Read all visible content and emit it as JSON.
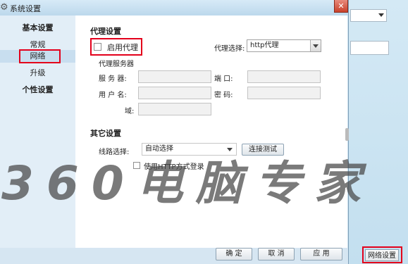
{
  "window": {
    "title": "系统设置",
    "close_label": "✕"
  },
  "sidebar": {
    "sections": [
      {
        "heading": "基本设置",
        "items": [
          "常规",
          "网络",
          "升级"
        ]
      },
      {
        "heading": "个性设置",
        "items": []
      }
    ],
    "selected": "网络"
  },
  "proxy": {
    "section_title": "代理设置",
    "enable_label": "启用代理",
    "enabled": false,
    "select_label": "代理选择:",
    "select_value": "http代理",
    "server_title": "代理服务器",
    "server_label": "服  务  器:",
    "port_label": "端     口:",
    "username_label": "用  户  名:",
    "password_label": "密     码:",
    "domain_label": "域:",
    "server_value": "",
    "port_value": "",
    "username_value": "",
    "password_value": "",
    "domain_value": ""
  },
  "other": {
    "section_title": "其它设置",
    "route_label": "线路选择:",
    "route_value": "自动选择",
    "test_button": "连接测试",
    "http_login_label": "使用HTTP方式登录",
    "http_login_checked": false
  },
  "footer": {
    "ok": "确 定",
    "cancel": "取 消",
    "apply": "应 用"
  },
  "background_window": {
    "network_settings_button": "网络设置"
  },
  "watermark": "360电脑专家",
  "colors": {
    "highlight_border": "#e3001b",
    "selected_item_bg": "#c8deef"
  }
}
